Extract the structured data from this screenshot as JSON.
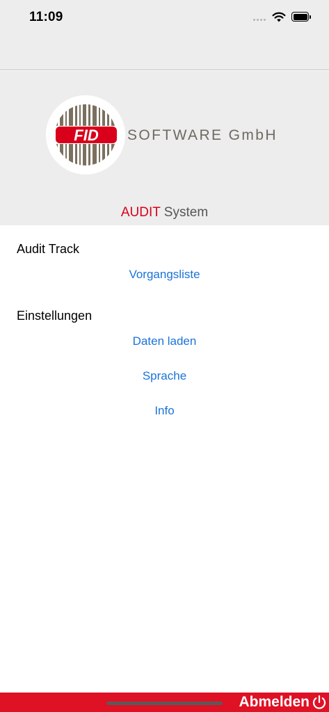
{
  "status_bar": {
    "time": "11:09"
  },
  "logo": {
    "brand_badge": "FID",
    "company_name": "SOFTWARE GmbH"
  },
  "app_title": {
    "highlight": "AUDIT",
    "rest": "System"
  },
  "menu": {
    "sections": [
      {
        "header": "Audit Track",
        "items": [
          "Vorgangsliste"
        ]
      },
      {
        "header": "Einstellungen",
        "items": [
          "Daten laden",
          "Sprache",
          "Info"
        ]
      }
    ]
  },
  "footer": {
    "logout_label": "Abmelden"
  },
  "colors": {
    "accent_red": "#d9001b",
    "link_blue": "#1a73d9",
    "header_bg": "#ededed",
    "footer_red": "#df1125"
  },
  "icons": [
    "wifi-icon",
    "battery-icon",
    "cellular-icon",
    "power-icon",
    "fid-logo-icon"
  ]
}
